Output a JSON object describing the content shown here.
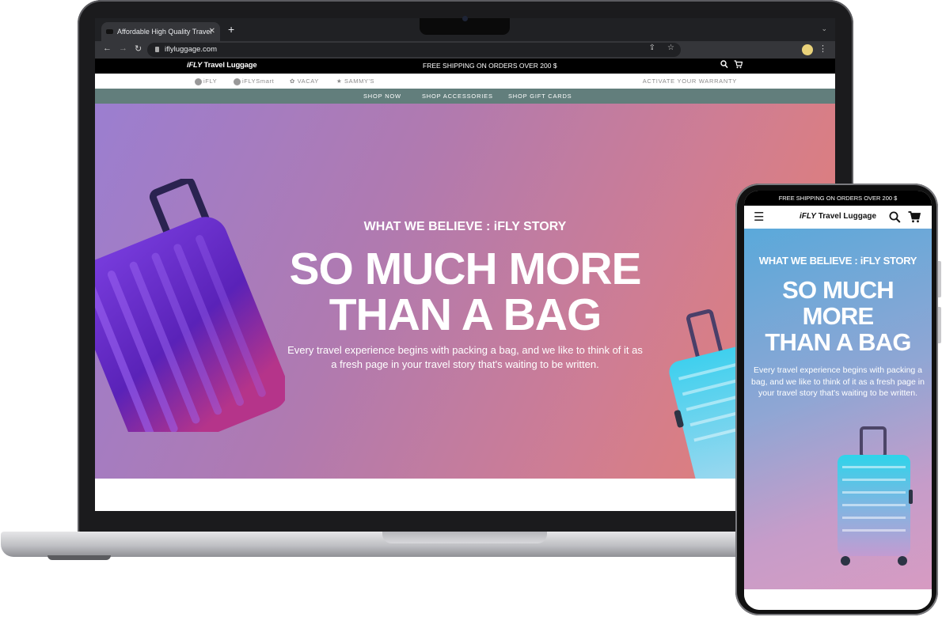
{
  "browser": {
    "tab_title": "Affordable High Quality Travel",
    "tab_close": "✕",
    "new_tab": "+",
    "tab_menu": "⌄",
    "url": "iflyluggage.com"
  },
  "site": {
    "logo_brand": "iFLY",
    "logo_text": "Travel Luggage",
    "shipping_banner": "FREE SHIPPING ON ORDERS  OVER 200 $",
    "brands": [
      "iFLY",
      "iFLYSmart",
      "VACAY",
      "SAMMY'S"
    ],
    "warranty": "ACTIVATE YOUR WARRANTY",
    "menu": [
      "SHOP NOW",
      "SHOP ACCESSORIES",
      "SHOP GIFT CARDS"
    ],
    "hero": {
      "kicker": "WHAT WE BELIEVE : iFLY STORY",
      "title_line1": "SO MUCH MORE",
      "title_line2": "THAN A BAG",
      "text": "Every travel experience begins with packing a bag, and we like to think of it as a fresh page in your travel story that's waiting to be written."
    }
  },
  "mobile": {
    "shipping_banner": "FREE SHIPPING ON ORDERS  OVER 200 $",
    "logo_brand": "iFLY",
    "logo_text": "Travel Luggage",
    "hero": {
      "kicker": "WHAT WE BELIEVE : iFLY STORY",
      "title_line1": "SO MUCH",
      "title_line2": "MORE",
      "title_line3": "THAN A BAG",
      "text": "Every travel experience begins with packing a bag, and we like to think of it as a fresh page in your travel story that's waiting to be written."
    }
  },
  "icons": [
    "back-arrow-icon",
    "forward-arrow-icon",
    "reload-icon",
    "lock-icon",
    "share-icon",
    "bookmark-star-icon",
    "profile-avatar-icon",
    "kebab-menu-icon",
    "search-icon",
    "cart-icon",
    "hamburger-menu-icon",
    "star-icon"
  ],
  "colors": {
    "menu_bar": "#627e7c",
    "hero_gradient": [
      "#9b7ed0",
      "#e7806f"
    ],
    "mobile_hero_gradient": [
      "#5aa9da",
      "#d79bc2"
    ],
    "suitcase_purple": "#6a2cc4",
    "suitcase_teal": "#35c2e6"
  }
}
